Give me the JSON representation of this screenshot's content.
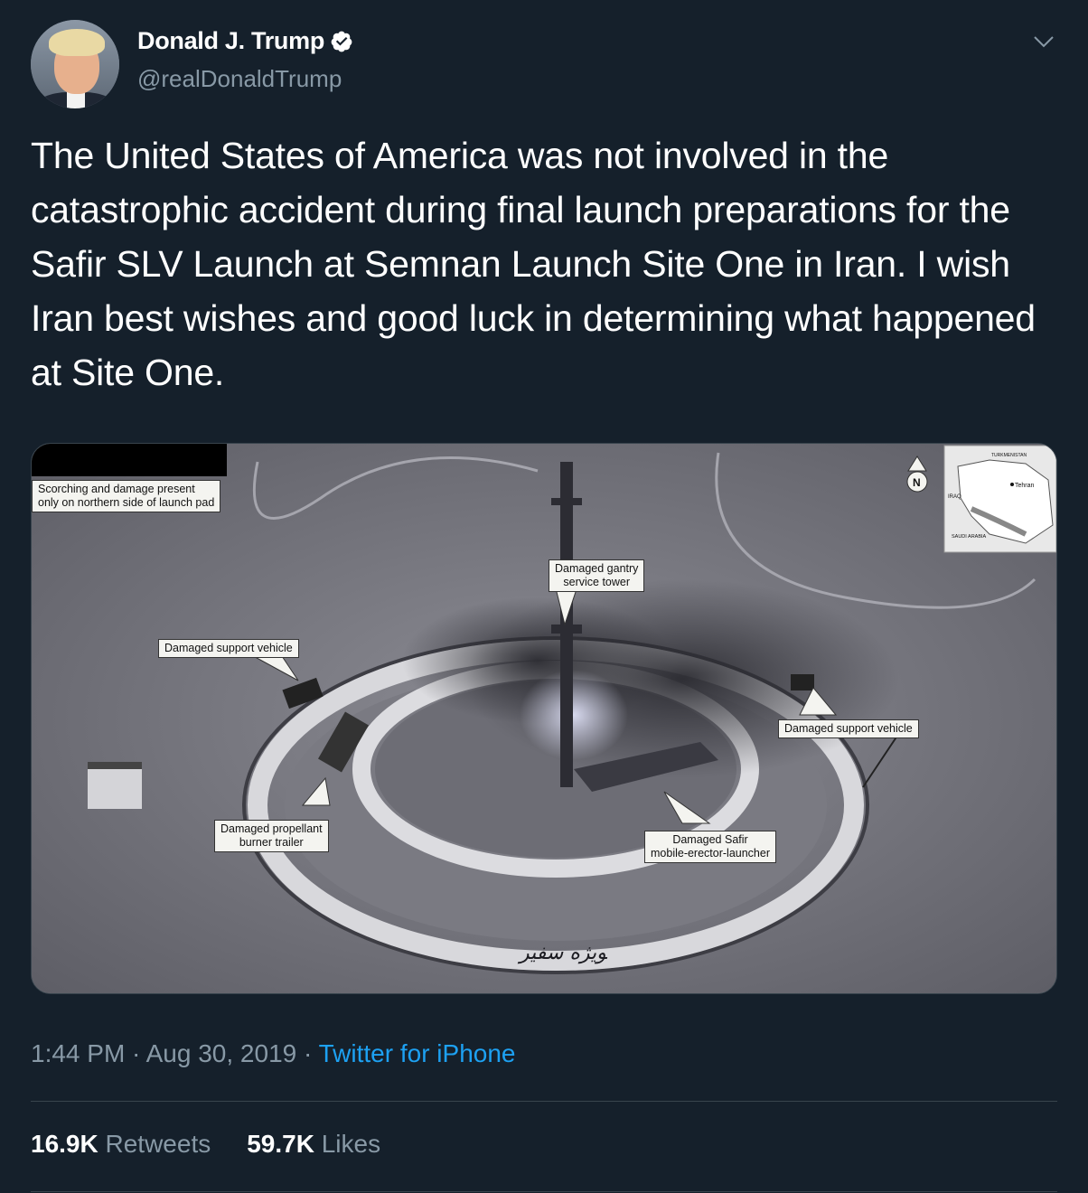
{
  "author": {
    "name": "Donald J. Trump",
    "handle": "@realDonaldTrump",
    "verified": true
  },
  "tweet": {
    "text": "The United States of America was not involved in the catastrophic accident during final launch preparations for the Safir SLV Launch at Semnan Launch Site One in Iran. I wish Iran best wishes and good luck in determining what happened at Site One."
  },
  "media": {
    "annotations": [
      {
        "text": "Scorching and damage present\nonly on northern side of launch pad"
      },
      {
        "text": "Damaged gantry\nservice tower"
      },
      {
        "text": "Damaged support vehicle"
      },
      {
        "text": "Damaged support vehicle"
      },
      {
        "text": "Damaged propellant\nburner trailer"
      },
      {
        "text": "Damaged Safir\nmobile-erector-launcher"
      }
    ],
    "north_marker": "N",
    "map_labels": {
      "tehran": "Tehran",
      "iraq": "IRAQ",
      "saudi_arabia": "SAUDI ARABIA",
      "turkmenistan": "TURKMENISTAN"
    }
  },
  "meta": {
    "time": "1:44 PM",
    "sep1": " · ",
    "date": "Aug 30, 2019",
    "sep2": " · ",
    "source": "Twitter for iPhone"
  },
  "stats": {
    "retweets_count": "16.9K",
    "retweets_label": "Retweets",
    "likes_count": "59.7K",
    "likes_label": "Likes"
  },
  "colors": {
    "background": "#15202b",
    "secondary_text": "#8899a6",
    "link": "#1da1f2",
    "border": "#38444d"
  },
  "icons": [
    "verified-badge-icon",
    "chevron-down-icon",
    "north-arrow-icon"
  ]
}
